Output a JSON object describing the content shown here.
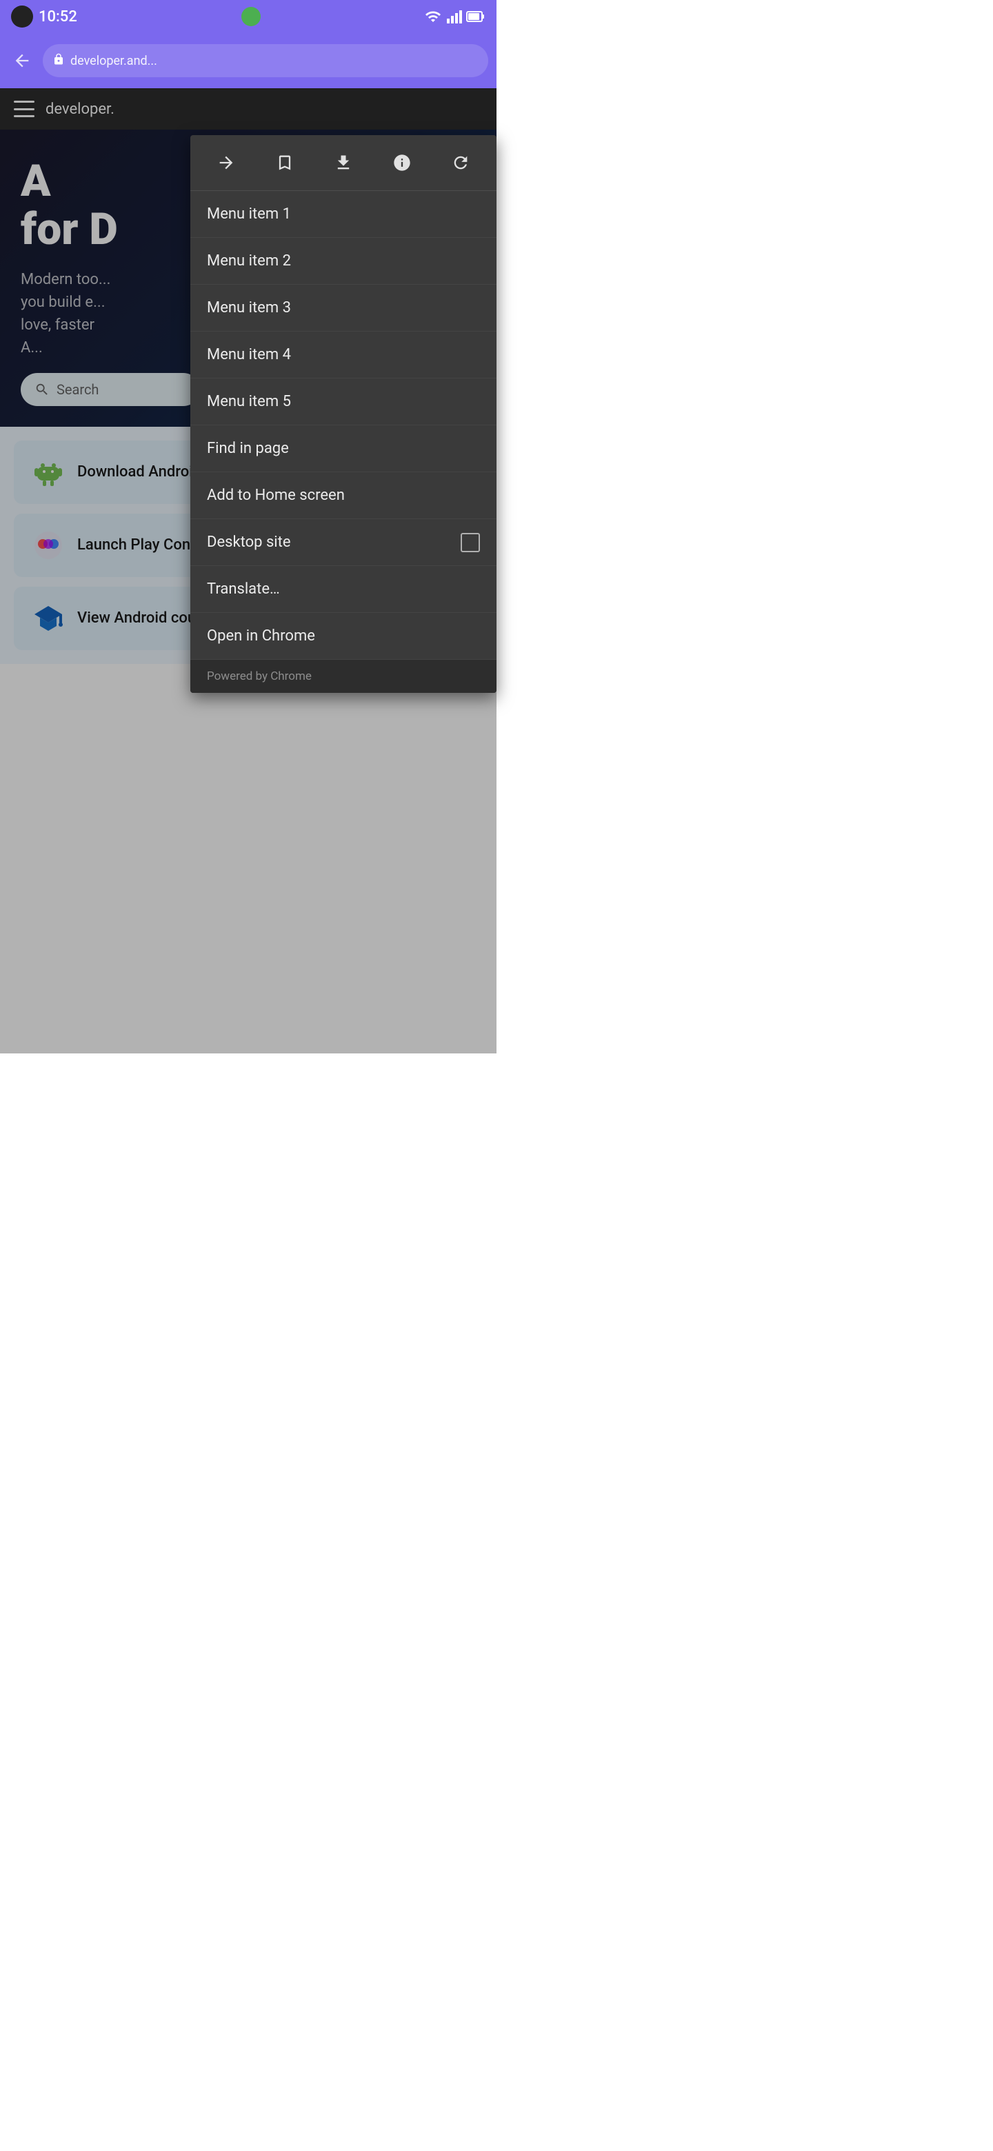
{
  "statusBar": {
    "time": "10:52"
  },
  "browserToolbar": {
    "addressText": "developer.and..."
  },
  "website": {
    "siteName": "developer.",
    "heroTitle1": "A",
    "heroTitle2": "for D",
    "heroSubtitle": "Modern too...\nyou build e...\nlove, faster\nA...",
    "searchPlaceholder": "Search"
  },
  "cards": [
    {
      "title": "Download Android Studio",
      "icon": "android-icon",
      "hasExternalLink": false,
      "hasDownloadIcon": true
    },
    {
      "title": "Launch Play Console",
      "icon": "play-icon",
      "hasExternalLink": true,
      "hasDownloadIcon": false
    },
    {
      "title": "View Android courses",
      "icon": "graduation-icon",
      "hasExternalLink": false,
      "hasDownloadIcon": false
    }
  ],
  "dropdownMenu": {
    "icons": [
      {
        "name": "forward-icon",
        "label": "Forward",
        "active": false
      },
      {
        "name": "bookmark-icon",
        "label": "Bookmark",
        "active": false
      },
      {
        "name": "download-icon",
        "label": "Download",
        "active": false
      },
      {
        "name": "info-icon",
        "label": "Info",
        "active": false
      },
      {
        "name": "refresh-icon",
        "label": "Refresh",
        "active": false
      }
    ],
    "items": [
      {
        "id": "menu-item-1",
        "label": "Menu item 1",
        "hasCheckbox": false
      },
      {
        "id": "menu-item-2",
        "label": "Menu item 2",
        "hasCheckbox": false
      },
      {
        "id": "menu-item-3",
        "label": "Menu item 3",
        "hasCheckbox": false
      },
      {
        "id": "menu-item-4",
        "label": "Menu item 4",
        "hasCheckbox": false
      },
      {
        "id": "menu-item-5",
        "label": "Menu item 5",
        "hasCheckbox": false
      },
      {
        "id": "find-in-page",
        "label": "Find in page",
        "hasCheckbox": false
      },
      {
        "id": "add-to-home",
        "label": "Add to Home screen",
        "hasCheckbox": false
      },
      {
        "id": "desktop-site",
        "label": "Desktop site",
        "hasCheckbox": true
      },
      {
        "id": "translate",
        "label": "Translate…",
        "hasCheckbox": false
      },
      {
        "id": "open-in-chrome",
        "label": "Open in Chrome",
        "hasCheckbox": false
      }
    ],
    "poweredBy": "Powered by Chrome"
  }
}
